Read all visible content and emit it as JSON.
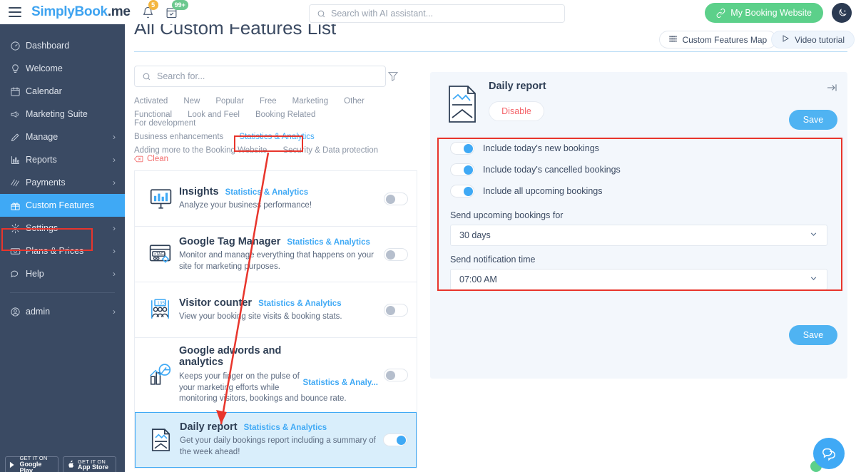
{
  "topbar": {
    "logo_primary": "SimplyBook",
    "logo_secondary": ".me",
    "notification_badge": "5",
    "calendar_badge": "99+",
    "search_placeholder": "Search with AI assistant...",
    "booking_website_label": "My Booking Website"
  },
  "sidebar": {
    "items": [
      {
        "label": "Dashboard",
        "icon": "gauge-icon",
        "chevron": false,
        "active": false
      },
      {
        "label": "Welcome",
        "icon": "bulb-icon",
        "chevron": false,
        "active": false
      },
      {
        "label": "Calendar",
        "icon": "calendar-icon",
        "chevron": false,
        "active": false
      },
      {
        "label": "Marketing Suite",
        "icon": "megaphone-icon",
        "chevron": false,
        "active": false
      },
      {
        "label": "Manage",
        "icon": "pencil-icon",
        "chevron": true,
        "active": false
      },
      {
        "label": "Reports",
        "icon": "bars-icon",
        "chevron": true,
        "active": false
      },
      {
        "label": "Payments",
        "icon": "cards-icon",
        "chevron": true,
        "active": false
      },
      {
        "label": "Custom Features",
        "icon": "gift-icon",
        "chevron": false,
        "active": true
      },
      {
        "label": "Settings",
        "icon": "gear-icon",
        "chevron": true,
        "active": false
      },
      {
        "label": "Plans & Prices",
        "icon": "money-icon",
        "chevron": true,
        "active": false
      },
      {
        "label": "Help",
        "icon": "chat-icon",
        "chevron": true,
        "active": false
      }
    ],
    "account": {
      "label": "admin",
      "icon": "user-icon",
      "chevron": true
    },
    "stores": [
      {
        "small": "GET IT ON",
        "big": "Google Play"
      },
      {
        "small": "GET IT ON",
        "big": "App Store"
      }
    ]
  },
  "page": {
    "title": "All Custom Features List",
    "actions": [
      {
        "label": "Custom Features Map",
        "icon": "grid-icon"
      },
      {
        "label": "Video tutorial",
        "icon": "play-icon"
      }
    ]
  },
  "features_panel": {
    "search_placeholder": "Search for...",
    "tag_rows": [
      [
        {
          "label": "Activated",
          "active": false
        },
        {
          "label": "New",
          "active": false
        },
        {
          "label": "Popular",
          "active": false
        },
        {
          "label": "Free",
          "active": false
        },
        {
          "label": "Marketing",
          "active": false
        },
        {
          "label": "Other",
          "active": false
        }
      ],
      [
        {
          "label": "Functional",
          "active": false
        },
        {
          "label": "Look and Feel",
          "active": false
        },
        {
          "label": "Booking Related",
          "active": false
        },
        {
          "label": "For development",
          "active": false
        }
      ],
      [
        {
          "label": "Business enhancements",
          "active": false
        },
        {
          "label": "Statistics & Analytics",
          "active": true
        }
      ],
      [
        {
          "label": "Adding more to the Booking Website",
          "active": false
        },
        {
          "label": "Security & Data protection",
          "active": false
        }
      ]
    ],
    "clean_label": "Clean",
    "cards": [
      {
        "title": "Insights",
        "category": "Statistics & Analytics",
        "description": "Analyze your business performance!",
        "icon": "monitor-chart-icon",
        "enabled": false,
        "selected": false
      },
      {
        "title": "Google Tag Manager",
        "category": "Statistics & Analytics",
        "description": "Monitor and manage everything that happens on your site for marketing purposes.",
        "icon": "tag-browser-icon",
        "enabled": false,
        "selected": false
      },
      {
        "title": "Visitor counter",
        "category": "Statistics & Analytics",
        "description": "View your booking site visits & booking stats.",
        "icon": "people-counter-icon",
        "enabled": false,
        "selected": false
      },
      {
        "title": "Google adwords and analytics",
        "category": "Statistics & Analy...",
        "description": "Keeps your finger on the pulse of your marketing efforts while monitoring visitors, bookings and bounce rate.",
        "icon": "google-chart-icon",
        "enabled": false,
        "selected": false,
        "stacked": true
      },
      {
        "title": "Daily report",
        "category": "Statistics & Analytics",
        "description": "Get your daily bookings report including a summary of the week ahead!",
        "icon": "report-document-icon",
        "enabled": true,
        "selected": true
      }
    ]
  },
  "detail_panel": {
    "title": "Daily report",
    "icon": "report-document-icon",
    "disable_label": "Disable",
    "save_label": "Save",
    "bottom_save_label": "Save",
    "toggles": [
      {
        "label": "Include today's new bookings",
        "on": true
      },
      {
        "label": "Include today's cancelled bookings",
        "on": true
      },
      {
        "label": "Include all upcoming bookings",
        "on": true
      }
    ],
    "fields": [
      {
        "label": "Send upcoming bookings for",
        "value": "30 days"
      },
      {
        "label": "Send notification time",
        "value": "07:00 AM"
      }
    ]
  },
  "colors": {
    "accent_blue": "#3fa9f5",
    "sidebar_bg": "#3a4a63",
    "green": "#5cd08a",
    "annotation_red": "#e8352c",
    "disable_red": "#f4656b"
  }
}
